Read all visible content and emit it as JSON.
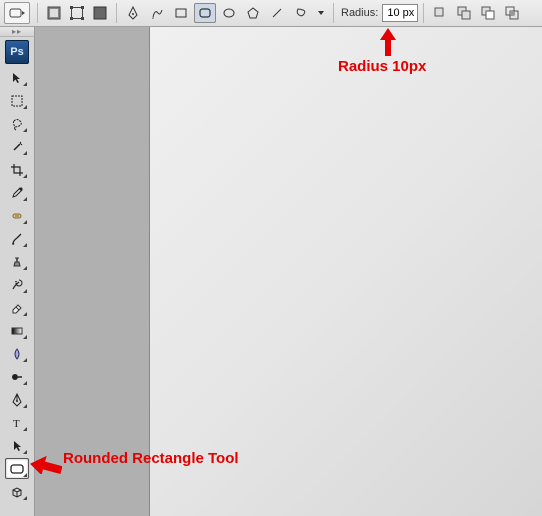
{
  "optionsBar": {
    "radius_label": "Radius:",
    "radius_value": "10 px"
  },
  "annotations": {
    "radius_callout": "Radius 10px",
    "tool_callout": "Rounded Rectangle Tool"
  },
  "toolbox": {
    "logo": "Ps"
  }
}
